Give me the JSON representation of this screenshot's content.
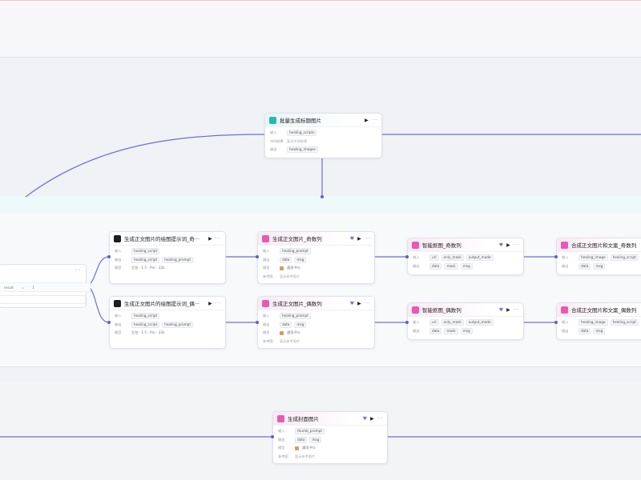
{
  "colors": {
    "wire": "#6b6fd6",
    "teal": "#29b8b0",
    "pink": "#e55bb1"
  },
  "labels": {
    "input": "输入",
    "output": "输出",
    "model": "模型",
    "ref": "参考图",
    "middle": "中间结果"
  },
  "left_node": {
    "var_name": "result",
    "eq": "=",
    "value": "1"
  },
  "nodes": {
    "batch": {
      "title": "批量生成标题图片",
      "icon": "teal-app-icon",
      "input": "healing_scripts",
      "middle": "暂无中间结果",
      "output": "healing_images"
    },
    "prompt_odd": {
      "title": "生成正文图片的绘图提示词_奇···",
      "input": "healing_script",
      "outputs": [
        "healing_script",
        "healing_prompt"
      ],
      "model": "豆包 · 1.5 · Pro · 32k"
    },
    "prompt_even": {
      "title": "生成正文图片的绘图提示词_偶···",
      "input": "healing_script",
      "outputs": [
        "healing_script",
        "healing_prompt"
      ],
      "model": "豆包 · 1.5 · Pro · 32k"
    },
    "img_odd": {
      "title": "生成正文图片_奇数列",
      "input": "healing_prompt",
      "outputs": [
        "data",
        "msg"
      ],
      "model": "通用-Pro",
      "ref": "暂无参考图片"
    },
    "img_even": {
      "title": "生成正文图片_偶数列",
      "input": "healing_prompt",
      "outputs": [
        "data",
        "msg"
      ],
      "model": "通用-Pro",
      "ref": "暂无参考图片"
    },
    "cutout_odd": {
      "title": "智能抠图_奇数列",
      "inputs": [
        "url",
        "only_mask",
        "output_mode"
      ],
      "outputs": [
        "data",
        "mask",
        "msg"
      ]
    },
    "cutout_even": {
      "title": "智能抠图_偶数列",
      "inputs": [
        "url",
        "only_mask",
        "output_mode"
      ],
      "outputs": [
        "data",
        "mask",
        "msg"
      ]
    },
    "merge_odd": {
      "title": "合成正文图片和文案_奇数列",
      "inputs": [
        "healing_image",
        "healing_script"
      ],
      "outputs": [
        "data",
        "msg"
      ]
    },
    "merge_even": {
      "title": "合成正文图片和文案_偶数列",
      "inputs": [
        "healing_image",
        "healing_script"
      ],
      "outputs": [
        "data",
        "msg"
      ]
    },
    "cover": {
      "title": "生成封面图片",
      "input": "thumb_prompt",
      "outputs": [
        "data",
        "msg"
      ],
      "model": "通用-Pro",
      "ref": "暂无参考图片"
    }
  }
}
